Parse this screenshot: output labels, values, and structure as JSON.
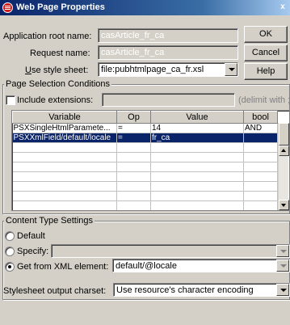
{
  "window": {
    "title": "Web Page Properties",
    "close_label": "x"
  },
  "fields": {
    "app_root_label": "Application root name:",
    "app_root_value": "casArticle_fr_ca",
    "request_name_label": "Request name:",
    "request_name_value": "casArticle_fr_ca",
    "style_sheet_label_pre": "U",
    "style_sheet_label_post": "se style sheet:",
    "style_sheet_value": "file:pubhtmlpage_ca_fr.xsl"
  },
  "buttons": {
    "ok": "OK",
    "cancel": "Cancel",
    "help": "Help"
  },
  "page_selection": {
    "title": "Page Selection Conditions",
    "include_ext_label": "Include extensions:",
    "include_ext_hint": "(delimit with ;)",
    "columns": [
      "Variable",
      "Op",
      "Value",
      "bool"
    ],
    "rows": [
      {
        "variable": "PSXSingleHtmlParamete...",
        "op": "=",
        "value": "14",
        "bool": "AND",
        "selected": false
      },
      {
        "variable": "PSXXmlField/default/locale",
        "op": "=",
        "value": "fr_ca",
        "bool": "",
        "selected": true
      }
    ],
    "empty_rows": 13
  },
  "content_type": {
    "title": "Content Type Settings",
    "default_label": "Default",
    "specify_label": "Specify:",
    "xml_label": "Get from XML element:",
    "xml_value": "default/@locale"
  },
  "charset": {
    "label": "Stylesheet output charset:",
    "value": "Use resource's character encoding"
  },
  "colors": {
    "selection": "#0a246a",
    "face": "#d4d0c8"
  }
}
